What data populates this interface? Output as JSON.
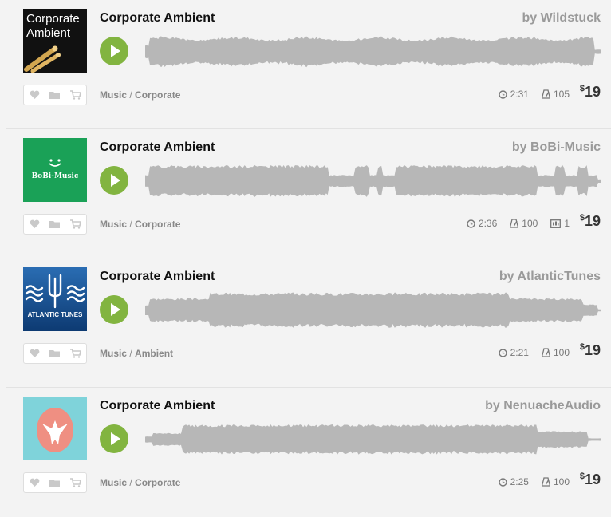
{
  "colors": {
    "play_button": "#82b440",
    "waveform": "#b7b7b7",
    "background": "#f3f3f3"
  },
  "items": [
    {
      "title": "Corporate Ambient",
      "author": "by Wildstuck",
      "category": "Music",
      "subcategory": "Corporate",
      "duration": "2:31",
      "bpm": "105",
      "price_currency": "$",
      "price": "19",
      "thumbnail": {
        "text_line1": "Corporate",
        "text_line2": "Ambient",
        "icon": "drumsticks-icon",
        "bg": "#111111"
      }
    },
    {
      "title": "Corporate Ambient",
      "author": "by BoBi-Music",
      "category": "Music",
      "subcategory": "Corporate",
      "duration": "2:36",
      "bpm": "100",
      "versions": "1",
      "price_currency": "$",
      "price": "19",
      "thumbnail": {
        "text_line1": "BoBi-Music",
        "icon": "smiley-icon",
        "bg": "#1aa157"
      }
    },
    {
      "title": "Corporate Ambient",
      "author": "by AtlanticTunes",
      "category": "Music",
      "subcategory": "Ambient",
      "duration": "2:21",
      "bpm": "100",
      "price_currency": "$",
      "price": "19",
      "thumbnail": {
        "text_line1": "ATLANTIC TUNES",
        "icon": "trident-waves-icon",
        "bg": "#1d5a9a"
      }
    },
    {
      "title": "Corporate Ambient",
      "author": "by NenuacheAudio",
      "category": "Music",
      "subcategory": "Corporate",
      "duration": "2:25",
      "bpm": "100",
      "price_currency": "$",
      "price": "19",
      "thumbnail": {
        "icon": "dove-egg-icon",
        "bg": "#7fd3da"
      }
    }
  ]
}
